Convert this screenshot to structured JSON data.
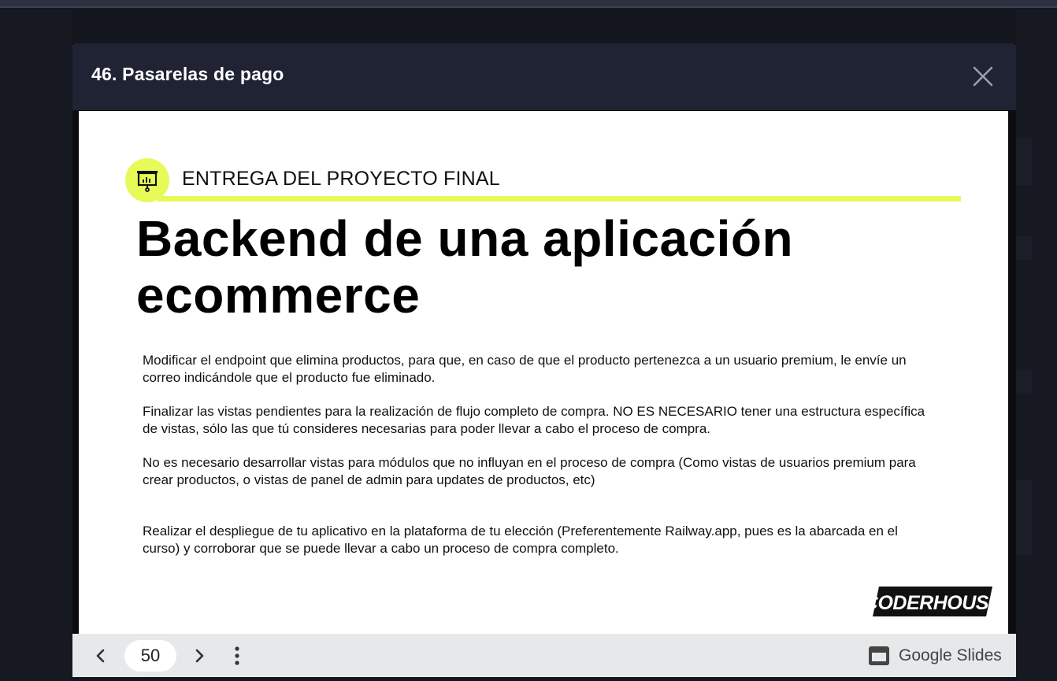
{
  "modal": {
    "title": "46. Pasarelas de pago"
  },
  "slide": {
    "kicker": "ENTREGA DEL PROYECTO FINAL",
    "title_line1": "Backend de una aplicación",
    "title_line2": "ecommerce",
    "paragraphs": [
      "Modificar el endpoint que elimina productos, para que, en caso de que el producto pertenezca a un usuario premium, le envíe un correo indicándole que el producto fue eliminado.",
      "Finalizar las vistas pendientes para la realización de flujo completo de compra. NO ES NECESARIO tener una estructura específica de vistas, sólo las que tú consideres necesarias para poder llevar a cabo el proceso de compra.",
      "No es necesario desarrollar vistas para módulos que no influyan en el proceso de compra (Como vistas de usuarios premium para crear productos, o vistas de panel de admin para updates de productos, etc)",
      "Realizar el despliegue de tu aplicativo en la plataforma de tu elección (Preferentemente Railway.app, pues es la abarcada en el curso) y corroborar que se puede llevar a cabo un proceso de compra completo."
    ],
    "logo_text": "CODERHOUSE"
  },
  "toolbar": {
    "page_number": "50",
    "google_slides_label": "Google Slides"
  },
  "colors": {
    "accent": "#e7fa58",
    "header_bg": "#1f2334",
    "page_bg": "#14161e",
    "toolbar_bg": "#e7e8ea"
  },
  "icons": [
    "close-icon",
    "presentation-icon",
    "chevron-left-icon",
    "chevron-right-icon",
    "more-vert-icon",
    "slides-icon"
  ]
}
